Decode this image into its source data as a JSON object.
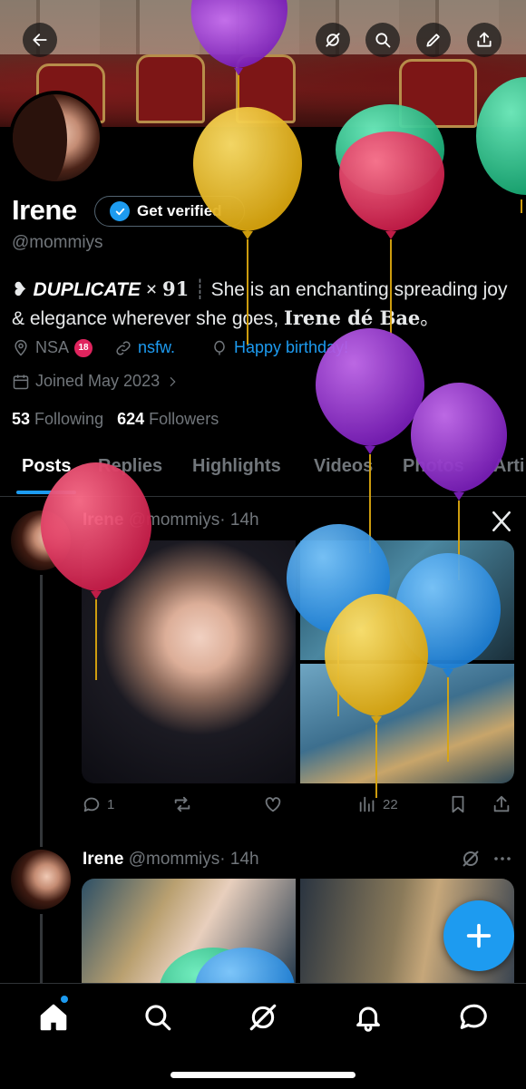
{
  "profile": {
    "name": "Irene",
    "get_verified": "Get verified",
    "handle": "@mommiys",
    "bio": {
      "prefix_icon": "❥",
      "duplicate": "DUPLICATE",
      "times": "×",
      "count": "91",
      "divider": "┊",
      "text": "She is an enchanting spreading joy & elegance wherever she goes,",
      "signature": "Irene dé Bae",
      "end": "。"
    },
    "location": "NSA",
    "age_badge": "18",
    "website": "nsfw.",
    "birthday": "Happy birthday!",
    "joined": "Joined May 2023",
    "following_count": "53",
    "following_label": "Following",
    "followers_count": "624",
    "followers_label": "Followers"
  },
  "tabs": [
    "Posts",
    "Replies",
    "Highlights",
    "Videos",
    "Photos",
    "Arti"
  ],
  "posts": [
    {
      "author": "Irene",
      "handle": "@mommiys",
      "time": "· 14h",
      "replies": "1",
      "views": "22"
    },
    {
      "author": "Irene",
      "handle": "@mommiys",
      "time": "· 14h"
    }
  ],
  "icons": {
    "back": "arrow-left-icon",
    "grok": "grok-icon",
    "search": "search-icon",
    "edit": "pencil-icon",
    "share": "share-icon",
    "home": "home-icon",
    "explore": "search-icon",
    "notifications": "bell-icon",
    "messages": "chat-icon",
    "compose": "plus-icon"
  },
  "colors": {
    "accent": "#1d9bf0",
    "background": "#000000",
    "muted": "#71767b"
  }
}
